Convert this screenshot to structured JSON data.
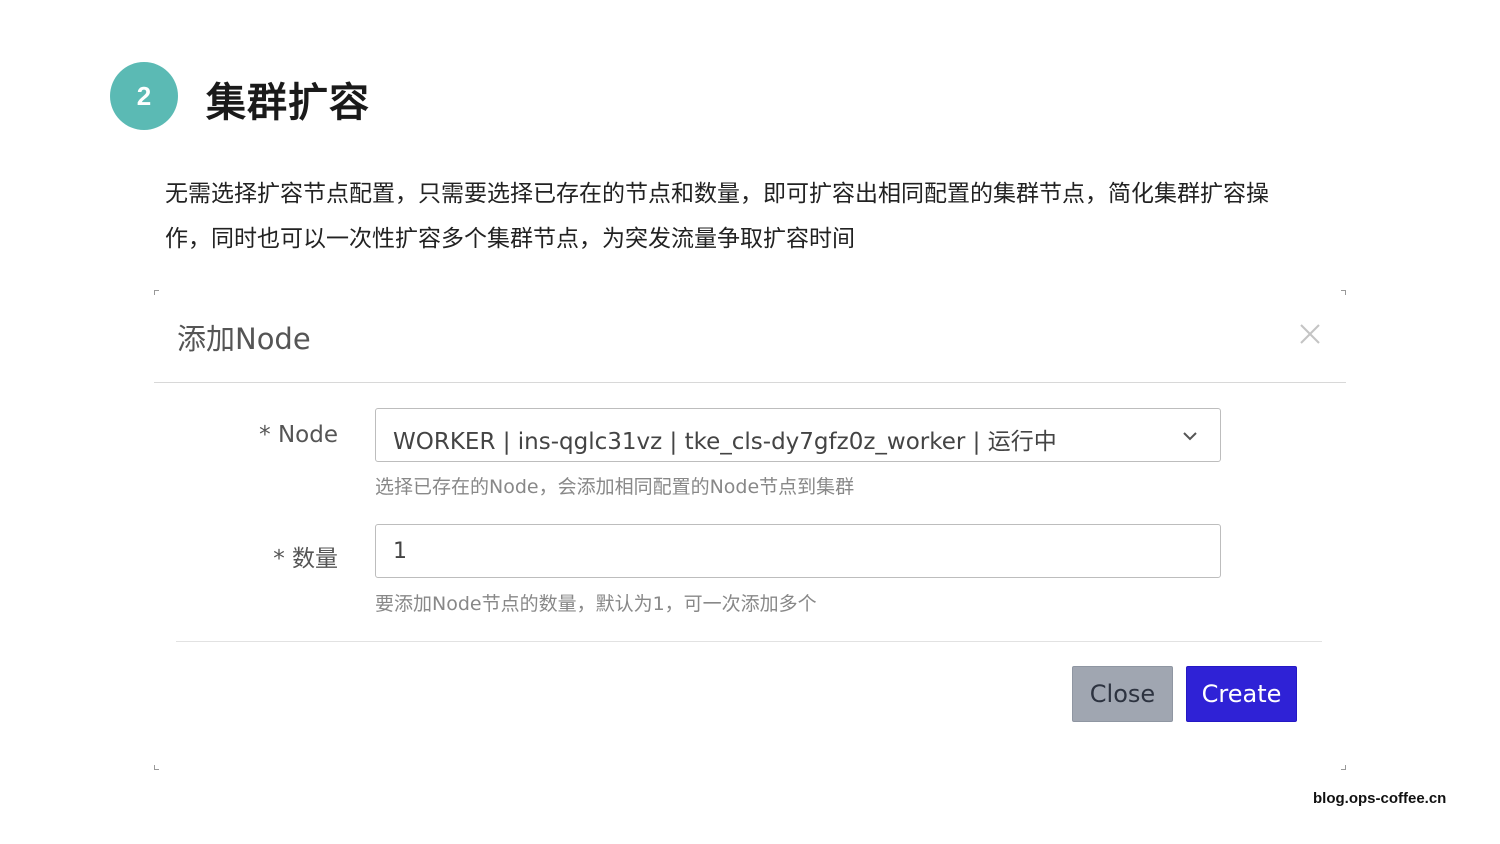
{
  "section": {
    "number": "2",
    "title": "集群扩容"
  },
  "description": {
    "line1": "无需选择扩容节点配置，只需要选择已存在的节点和数量，即可扩容出相同配置的集群节点，简化集群扩容操",
    "line2": "作，同时也可以一次性扩容多个集群节点，为突发流量争取扩容时间"
  },
  "dialog": {
    "title": "添加Node",
    "close_icon": "close-icon",
    "node_field": {
      "label": "* Node",
      "selected_value": "WORKER | ins-qglc31vz | tke_cls-dy7gfz0z_worker | 运行中",
      "hint": "选择已存在的Node，会添加相同配置的Node节点到集群",
      "icon": "chevron-down-icon"
    },
    "count_field": {
      "label": "* 数量",
      "value": "1",
      "hint": "要添加Node节点的数量，默认为1，可一次添加多个"
    },
    "buttons": {
      "close_label": "Close",
      "create_label": "Create"
    }
  },
  "watermark": "blog.ops-coffee.cn",
  "colors": {
    "badge": "#5bbab4",
    "create_button": "#2f22d6",
    "close_button": "#a0a6b1"
  }
}
